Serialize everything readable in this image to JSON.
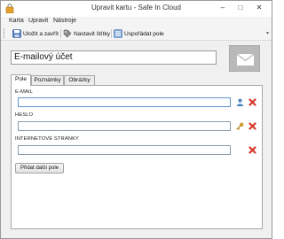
{
  "window": {
    "title": "Upravit kartu - Safe In Cloud"
  },
  "menu": {
    "items": [
      "Karta",
      "Upravit",
      "Nástroje"
    ]
  },
  "toolbar": {
    "save_label": "Uložit a zavřít",
    "tags_label": "Nastavit štítky",
    "arrange_label": "Uspořádat pole"
  },
  "card": {
    "title": "E-mailový účet"
  },
  "tabs": [
    "Pole",
    "Poznámky",
    "Obrázky"
  ],
  "fields": [
    {
      "label": "E-MAIL",
      "value": "",
      "icon": "user-icon"
    },
    {
      "label": "HESLO",
      "value": "",
      "icon": "key-icon"
    },
    {
      "label": "INTERNETOVÉ STRÁNKY",
      "value": "",
      "icon": ""
    }
  ],
  "add_field_label": "Přidat další pole",
  "colors": {
    "delete": "#d9352a",
    "accent_border": "#5b94cf",
    "image_bg": "#b9b9b9"
  }
}
